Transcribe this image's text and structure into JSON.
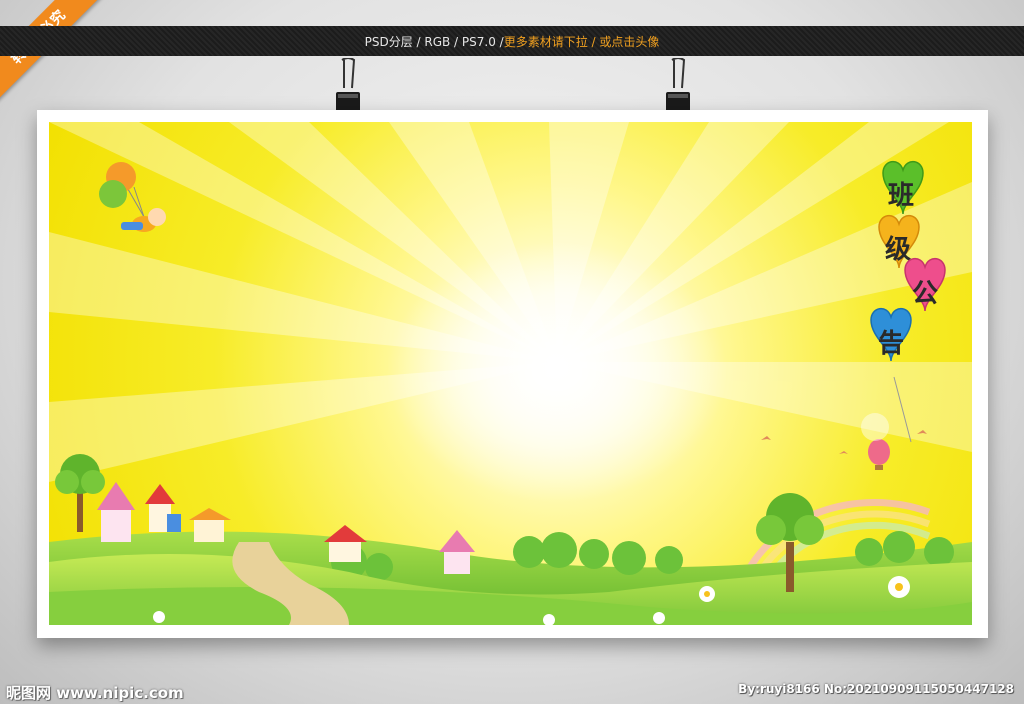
{
  "banner": {
    "text_main": "PSD分层 / RGB / PS7.0 / ",
    "text_orange": "更多素材请下拉 / 或点击头像"
  },
  "corner_ribbon": "转载•必究",
  "poster": {
    "heart_chars": [
      "班",
      "级",
      "公",
      "告"
    ],
    "heart_colors": [
      "#5bbf2a",
      "#f5b31c",
      "#ee4e8c",
      "#2e8fd8"
    ]
  },
  "watermark": {
    "left": "昵图网 www.nipic.com",
    "right": "By:ruyi8166 No:20210909115050447128"
  },
  "colors": {
    "topbar": "#222222",
    "accent_orange": "#f0a020",
    "ribbon": "#f18a1d",
    "sky_yellow": "#f2e000",
    "grass_green": "#8fd34a"
  }
}
